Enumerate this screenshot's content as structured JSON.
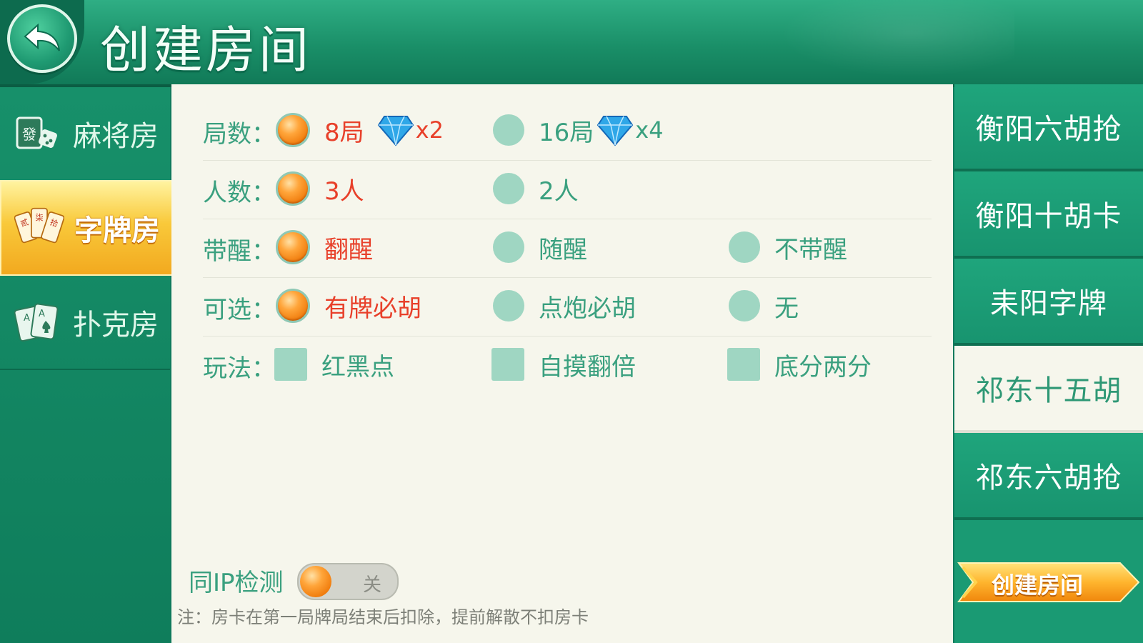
{
  "header": {
    "title": "创建房间",
    "back_icon": "back-arrow-icon"
  },
  "sidebar": {
    "items": [
      {
        "label": "麻将房",
        "icon": "mahjong-tile-icon",
        "active": false
      },
      {
        "label": "字牌房",
        "icon": "zipai-cards-icon",
        "active": true
      },
      {
        "label": "扑克房",
        "icon": "poker-cards-icon",
        "active": false
      }
    ]
  },
  "options": {
    "rounds": {
      "label": "局数",
      "choices": [
        {
          "text": "8局",
          "cost": "x2",
          "selected": true
        },
        {
          "text": "16局",
          "cost": "x4",
          "selected": false
        }
      ]
    },
    "players": {
      "label": "人数",
      "choices": [
        {
          "text": "3人",
          "selected": true
        },
        {
          "text": "2人",
          "selected": false
        }
      ]
    },
    "xing": {
      "label": "带醒",
      "choices": [
        {
          "text": "翻醒",
          "selected": true
        },
        {
          "text": "随醒",
          "selected": false
        },
        {
          "text": "不带醒",
          "selected": false
        }
      ]
    },
    "optional": {
      "label": "可选",
      "choices": [
        {
          "text": "有牌必胡",
          "selected": true
        },
        {
          "text": "点炮必胡",
          "selected": false
        },
        {
          "text": "无",
          "selected": false
        }
      ]
    },
    "rules": {
      "label": "玩法",
      "choices": [
        {
          "text": "红黑点",
          "checked": false
        },
        {
          "text": "自摸翻倍",
          "checked": false
        },
        {
          "text": "底分两分",
          "checked": false
        }
      ]
    },
    "label_colon": "："
  },
  "ip_check": {
    "label": "同IP检测",
    "state": "关",
    "on": false
  },
  "note": "注：房卡在第一局牌局结束后扣除，提前解散不扣房卡",
  "games": [
    {
      "label": "衡阳六胡抢",
      "active": false
    },
    {
      "label": "衡阳十胡卡",
      "active": false
    },
    {
      "label": "耒阳字牌",
      "active": false
    },
    {
      "label": "祁东十五胡",
      "active": true
    },
    {
      "label": "祁东六胡抢",
      "active": false
    }
  ],
  "create_button": {
    "label": "创建房间"
  },
  "colors": {
    "accent_green": "#3aa07f",
    "selected_red": "#e8402a",
    "orange": "#f07c0d",
    "panel_bg": "#f6f6ec"
  }
}
